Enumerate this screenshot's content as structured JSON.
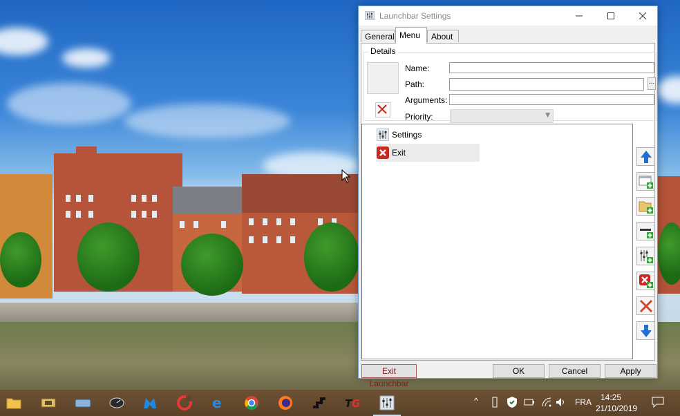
{
  "window": {
    "title": "Launchbar Settings",
    "tabs": [
      {
        "label": "General"
      },
      {
        "label": "Menu"
      },
      {
        "label": "About"
      }
    ],
    "active_tab": "Menu"
  },
  "details": {
    "legend": "Details",
    "name_label": "Name:",
    "name_value": "",
    "path_label": "Path:",
    "path_value": "",
    "browse_label": "...",
    "arguments_label": "Arguments:",
    "arguments_value": "",
    "priority_label": "Priority:",
    "priority_value": ""
  },
  "menu_items": [
    {
      "label": "Settings",
      "icon": "settings-sliders-icon"
    },
    {
      "label": "Exit",
      "icon": "exit-red-x-icon",
      "selected": true
    }
  ],
  "side_buttons": [
    "move-up-icon",
    "add-app-icon",
    "add-folder-icon",
    "add-separator-icon",
    "add-settings-icon",
    "add-exit-icon",
    "delete-icon",
    "move-down-icon"
  ],
  "footer": {
    "exit_launchbar": "Exit Launchbar",
    "ok": "OK",
    "cancel": "Cancel",
    "apply": "Apply"
  },
  "taskbar": {
    "language": "FRA",
    "time": "14:25",
    "date": "21/10/2019"
  },
  "colors": {
    "accent": "#6e9cd3",
    "taskbar": "#5e452c",
    "exit_red": "#c8281e",
    "arrow_blue": "#1f6fd0",
    "add_green": "#3aa13a"
  }
}
